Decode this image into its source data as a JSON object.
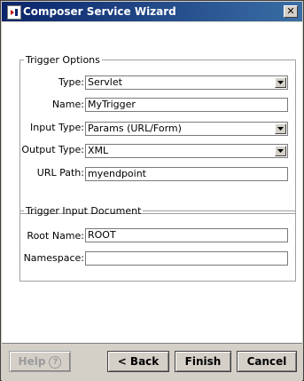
{
  "window": {
    "title": "Composer Service Wizard"
  },
  "trigger_options": {
    "legend": "Trigger Options",
    "type": {
      "label": "Type:",
      "value": "Servlet"
    },
    "name": {
      "label": "Name:",
      "value": "MyTrigger"
    },
    "input_type": {
      "label": "Input Type:",
      "value": "Params (URL/Form)"
    },
    "output_type": {
      "label": "Output Type:",
      "value": "XML"
    },
    "url_path": {
      "label": "URL Path:",
      "value": "myendpoint"
    }
  },
  "trigger_input_document": {
    "legend": "Trigger Input Document",
    "root_name": {
      "label": "Root Name:",
      "value": "ROOT"
    },
    "namespace": {
      "label": "Namespace:",
      "value": ""
    }
  },
  "buttons": {
    "help": "Help",
    "help_icon": "?",
    "back": "< Back",
    "finish": "Finish",
    "cancel": "Cancel"
  },
  "icons": {
    "close": "close-x-icon",
    "app": "app-icon",
    "dropdown": "chevron-down-icon"
  }
}
